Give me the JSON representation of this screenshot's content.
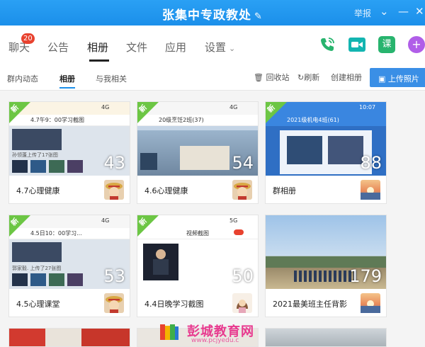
{
  "window": {
    "title": "张集中专政教处",
    "report_label": "举报"
  },
  "main_tabs": [
    {
      "label": "聊天",
      "badge": "20"
    },
    {
      "label": "公告"
    },
    {
      "label": "相册"
    },
    {
      "label": "文件"
    },
    {
      "label": "应用"
    },
    {
      "label": "设置"
    }
  ],
  "actions": {
    "lesson_label": "课"
  },
  "sub_tabs": [
    "群内动态",
    "相册",
    "与我相关"
  ],
  "toolbar": {
    "recycle_label": "回收站",
    "refresh_label": "刷新",
    "create_label": "创建相册",
    "upload_label": "上传照片"
  },
  "new_tag": "新",
  "albums": [
    {
      "name": "4.7心理健康",
      "count": "43",
      "new": true,
      "cover_top": "4.7午9：00学习截图",
      "status": "4G"
    },
    {
      "name": "4.6心理健康",
      "count": "54",
      "new": true,
      "cover_top": "20级烹饪2班(37)",
      "status": "4G"
    },
    {
      "name": "群相册",
      "count": "88",
      "new": true,
      "cover_top": "2021级机电4班(61)",
      "status": "10:07"
    },
    {
      "name": "4.5心理课堂",
      "count": "53",
      "new": true,
      "cover_top": "4.5日10：00学习...",
      "status": "4G"
    },
    {
      "name": "4.4日晚学习截图",
      "count": "50",
      "new": true,
      "cover_top": "视频截图",
      "status": "5G"
    },
    {
      "name": "2021最美班主任背影",
      "count": "179",
      "new": false,
      "cover_top": "",
      "status": ""
    }
  ],
  "cover_notes": {
    "album1": "孙领蓬上传了17张图",
    "album4": "郭家毅. 上传了27张图"
  },
  "watermark": {
    "name": "彭城教育网",
    "url": "www.pcjyedu.c"
  },
  "colors": {
    "titlebar": "#1b8fea",
    "accent": "#3a8fe6",
    "new_tag": "#6cc644",
    "badge": "#e8422f",
    "action_green": "#28b46e",
    "action_teal": "#13b5b1",
    "action_purple": "#b05ee8"
  }
}
